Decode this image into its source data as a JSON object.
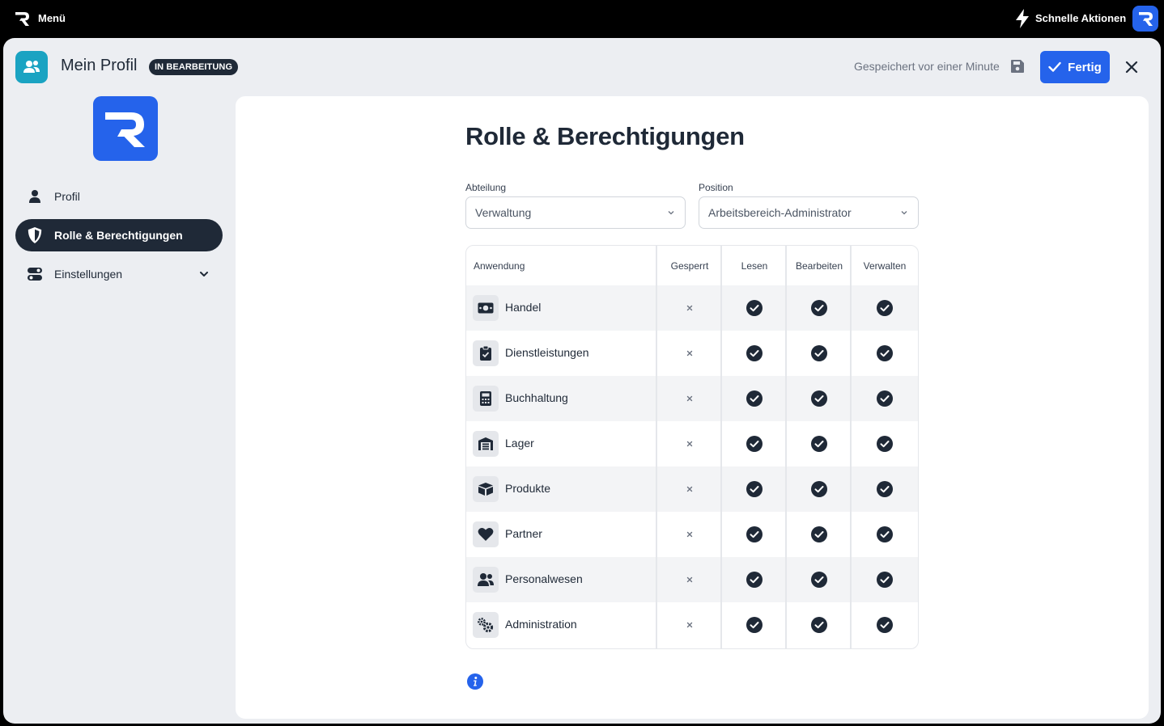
{
  "topbar": {
    "menu_label": "Menü",
    "quick_actions_label": "Schnelle Aktionen"
  },
  "header": {
    "title": "Mein Profil",
    "badge": "IN BEARBEITUNG",
    "saved_status": "Gespeichert vor einer Minute",
    "done_label": "Fertig"
  },
  "sidebar": {
    "items": [
      {
        "label": "Profil",
        "icon": "user-icon",
        "active": false
      },
      {
        "label": "Rolle & Berechtigungen",
        "icon": "shield-icon",
        "active": true
      },
      {
        "label": "Einstellungen",
        "icon": "toggles-icon",
        "active": false,
        "expandable": true
      }
    ]
  },
  "main": {
    "title": "Rolle & Berechtigungen",
    "department": {
      "label": "Abteilung",
      "value": "Verwaltung"
    },
    "position": {
      "label": "Position",
      "value": "Arbeitsbereich-Administrator"
    },
    "table": {
      "columns": [
        "Anwendung",
        "Gesperrt",
        "Lesen",
        "Bearbeiten",
        "Verwalten"
      ],
      "rows": [
        {
          "name": "Handel",
          "icon": "money-icon",
          "locked": false,
          "read": true,
          "edit": true,
          "manage": true
        },
        {
          "name": "Dienstleistungen",
          "icon": "clipboard-check-icon",
          "locked": false,
          "read": true,
          "edit": true,
          "manage": true
        },
        {
          "name": "Buchhaltung",
          "icon": "calculator-icon",
          "locked": false,
          "read": true,
          "edit": true,
          "manage": true
        },
        {
          "name": "Lager",
          "icon": "warehouse-icon",
          "locked": false,
          "read": true,
          "edit": true,
          "manage": true
        },
        {
          "name": "Produkte",
          "icon": "boxes-icon",
          "locked": false,
          "read": true,
          "edit": true,
          "manage": true
        },
        {
          "name": "Partner",
          "icon": "heart-icon",
          "locked": false,
          "read": true,
          "edit": true,
          "manage": true
        },
        {
          "name": "Personalwesen",
          "icon": "users-icon",
          "locked": false,
          "read": true,
          "edit": true,
          "manage": true
        },
        {
          "name": "Administration",
          "icon": "gears-icon",
          "locked": false,
          "read": true,
          "edit": true,
          "manage": true
        }
      ]
    }
  },
  "colors": {
    "accent": "#2563eb",
    "dark": "#1f2937",
    "header_icon_bg": "#1aa3c2",
    "window_bg": "#eceef2"
  }
}
